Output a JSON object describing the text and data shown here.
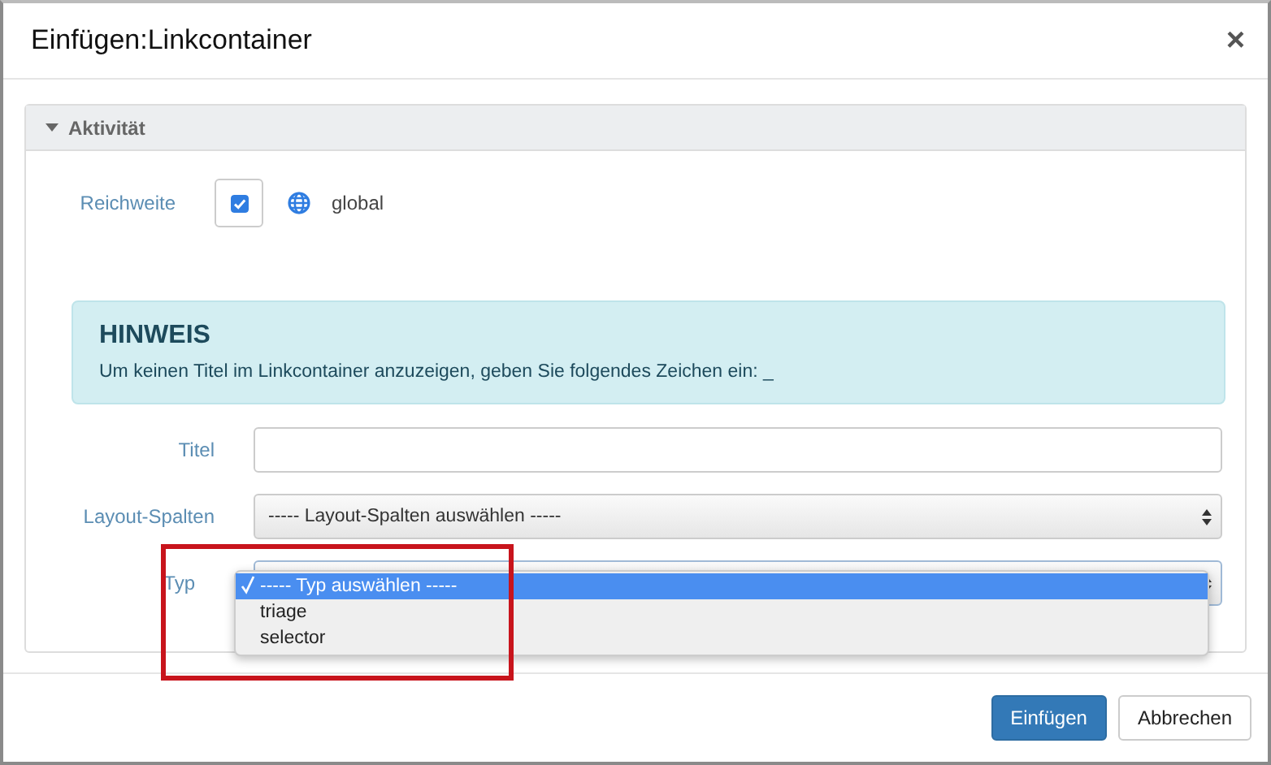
{
  "dialog": {
    "title": "Einfügen:Linkcontainer",
    "close": "×"
  },
  "section": {
    "title": "Aktivität",
    "expanded": true
  },
  "scope": {
    "label": "Reichweite",
    "checked": true,
    "value": "global"
  },
  "notice": {
    "heading": "HINWEIS",
    "text": "Um keinen Titel im Linkcontainer anzuzeigen, geben Sie folgendes Zeichen ein: _"
  },
  "fields": [
    {
      "kind": "text",
      "label": "Titel"
    },
    {
      "kind": "select",
      "label": "Layout-Spalten",
      "value": "----- Layout-Spalten auswählen -----"
    },
    {
      "kind": "select-open",
      "label": "Typ",
      "options": [
        {
          "label": "----- Typ auswählen -----",
          "selected": true
        },
        {
          "label": "triage",
          "selected": false
        },
        {
          "label": "selector",
          "selected": false
        }
      ]
    }
  ],
  "highlight": true,
  "buttons": [
    {
      "label": "Einfügen",
      "kind": "primary"
    },
    {
      "label": "Abbrechen",
      "kind": "default"
    }
  ]
}
